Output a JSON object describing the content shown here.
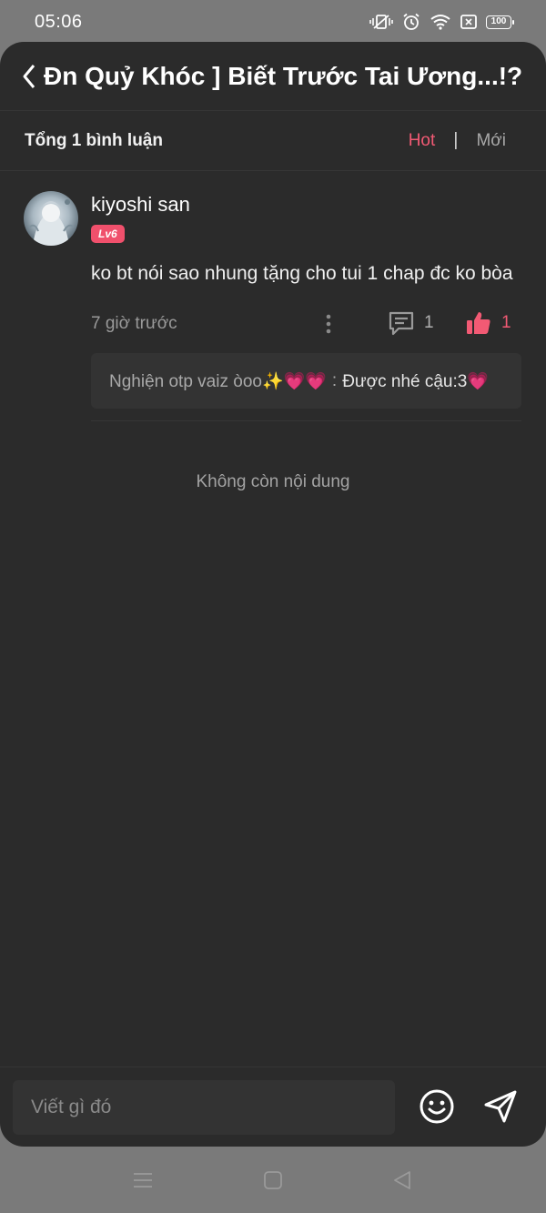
{
  "status_bar": {
    "time": "05:06",
    "battery": "100",
    "icons": [
      "vibrate-icon",
      "alarm-icon",
      "wifi-icon",
      "sim-icon",
      "battery-icon"
    ]
  },
  "header": {
    "title": "Đn Quỷ Khóc ] Biết Trước Tai Ương...!?"
  },
  "sub_header": {
    "total": "Tổng 1 bình luận",
    "sort_hot": "Hot",
    "sort_separator": "|",
    "sort_new": "Mới",
    "active_sort": "Hot"
  },
  "comments": [
    {
      "username": "kiyoshi san",
      "level": "Lv6",
      "text": "ko bt nói sao nhung tặng cho tui 1 chap đc ko bòa",
      "time": "7 giờ trước",
      "reply_count": "1",
      "like_count": "1",
      "reply": {
        "author": "Nghiện otp vaiz òoo✨💗💗",
        "separator": ":",
        "text": "Được nhé cậu:3💗"
      }
    }
  ],
  "end_message": "Không còn nội dung",
  "input": {
    "placeholder": "Viết gì đó"
  },
  "colors": {
    "accent": "#f25a74",
    "background": "#2b2b2b",
    "reply_box": "#333333"
  }
}
